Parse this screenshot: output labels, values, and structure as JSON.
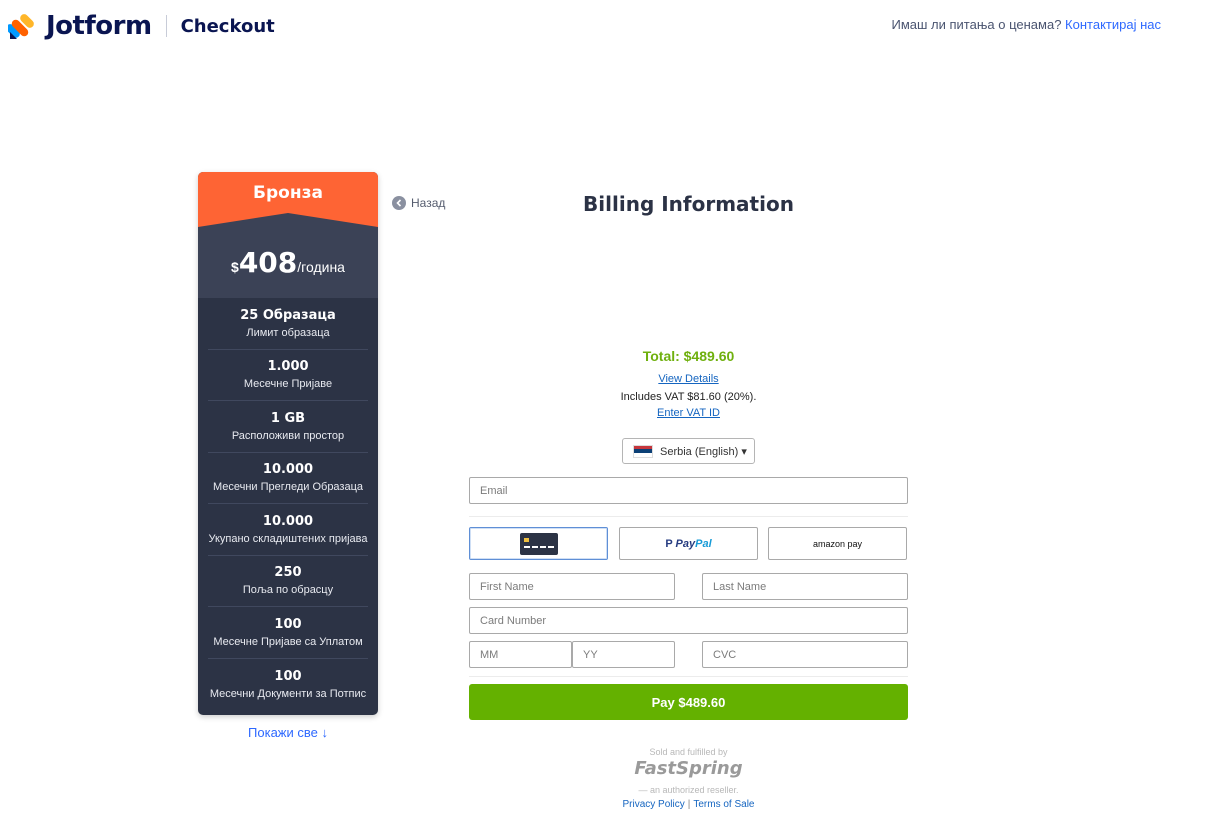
{
  "header": {
    "brand": "Jotform",
    "section": "Checkout",
    "contact_question": "Имаш ли питања о ценама?",
    "contact_link": "Контактирај нас"
  },
  "plan": {
    "name": "Бронза",
    "currency": "$",
    "price": "408",
    "period": "/година",
    "features": [
      {
        "value": "25 Образаца",
        "label": "Лимит образаца"
      },
      {
        "value": "1.000",
        "label": "Месечне Пријаве"
      },
      {
        "value": "1 GB",
        "label": "Расположиви простор"
      },
      {
        "value": "10.000",
        "label": "Месечни Прегледи Образаца"
      },
      {
        "value": "10.000",
        "label": "Укупано складиштених пријава"
      },
      {
        "value": "250",
        "label": "Поља по обрасцу"
      },
      {
        "value": "100",
        "label": "Месечне Пријаве са Уплатом"
      },
      {
        "value": "100",
        "label": "Месечни Документи за Потпис"
      }
    ],
    "show_all": "Покажи све ↓"
  },
  "billing": {
    "back": "Назад",
    "title": "Billing Information",
    "total": "Total: $489.60",
    "view_details": "View Details",
    "vat_text": "Includes VAT $81.60 (20%).",
    "enter_vat": "Enter VAT ID",
    "country": "Serbia (English) ▾",
    "email_placeholder": "Email",
    "payment_methods": {
      "paypal_a": "Pay",
      "paypal_b": "Pal",
      "amazon": "amazon pay"
    },
    "first_name_placeholder": "First Name",
    "last_name_placeholder": "Last Name",
    "card_number_placeholder": "Card Number",
    "mm_placeholder": "MM",
    "yy_placeholder": "YY",
    "cvc_placeholder": "CVC",
    "pay_button": "Pay $489.60"
  },
  "footer": {
    "sold_by": "Sold and fulfilled by",
    "fastspring": "FastSpring",
    "reseller": "— an authorized reseller.",
    "privacy": "Privacy Policy",
    "separator": "|",
    "terms": "Terms of Sale"
  },
  "colors": {
    "accent_orange": "#fe6434",
    "card_dark": "#2c3345",
    "pay_green": "#64b100",
    "total_green": "#6fb00e",
    "link_blue": "#1565c0"
  }
}
